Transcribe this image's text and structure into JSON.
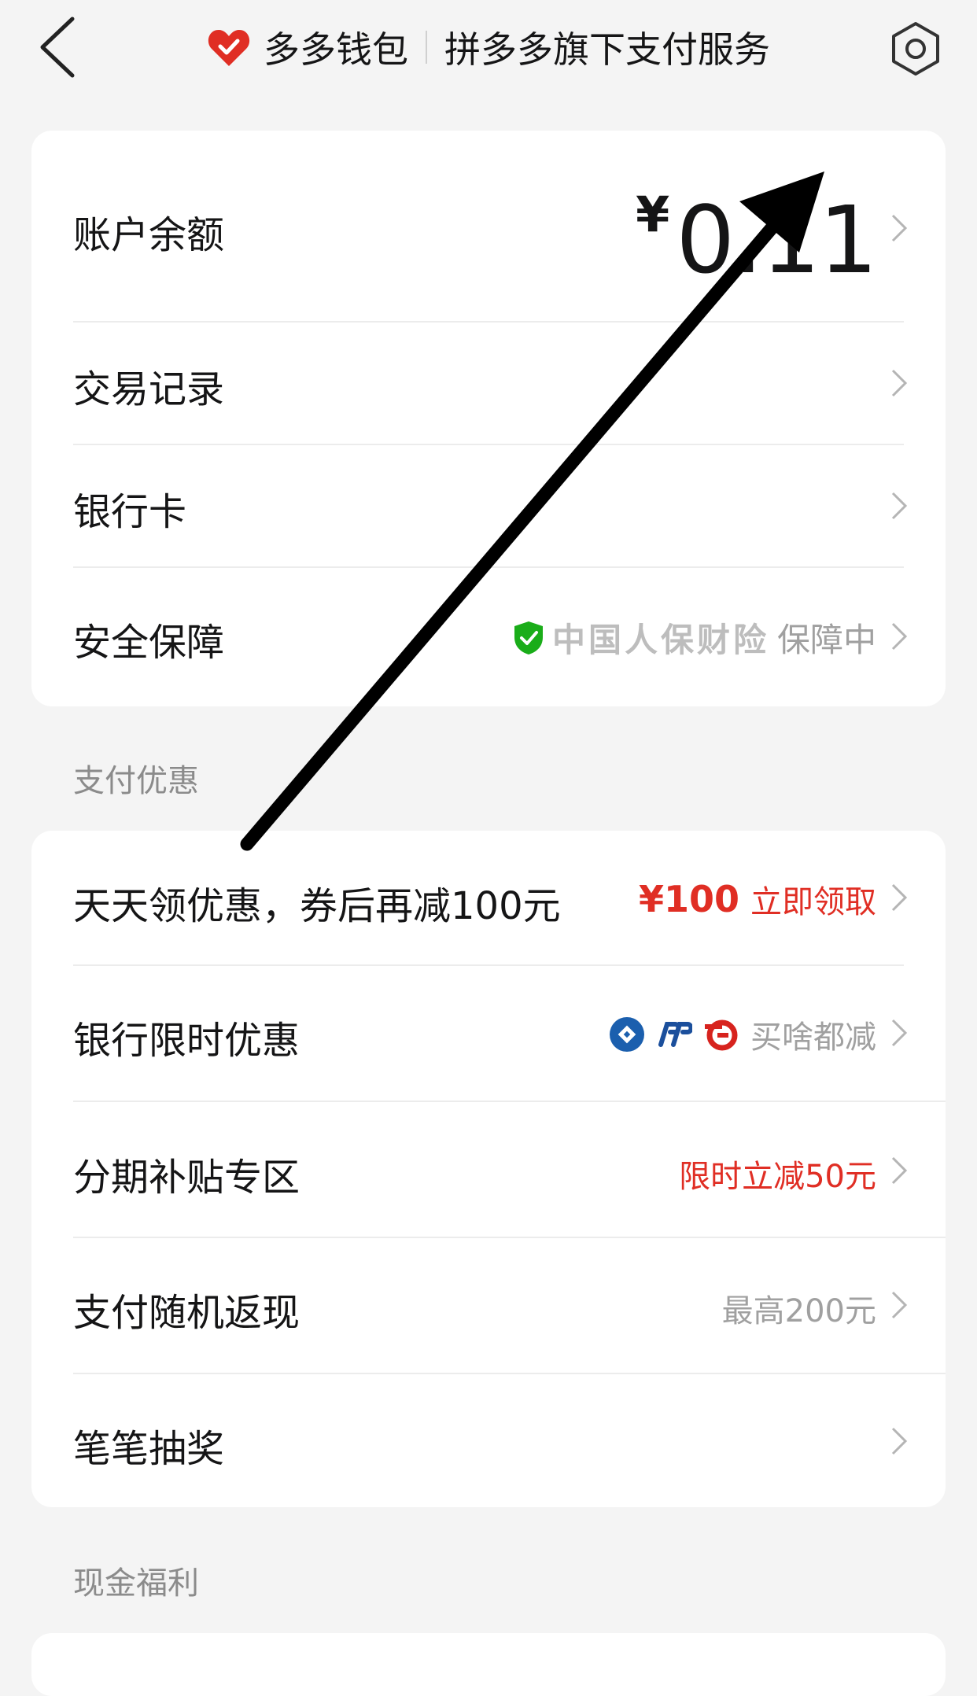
{
  "header": {
    "title": "多多钱包",
    "subtitle": "拼多多旗下支付服务"
  },
  "account": {
    "balance_label": "账户余额",
    "currency": "¥",
    "balance": "0.11",
    "records_label": "交易记录",
    "bank_card_label": "银行卡",
    "security_label": "安全保障",
    "insurer": "中国人保财险",
    "security_status": "保障中"
  },
  "promotions": {
    "section_title": "支付优惠",
    "items": [
      {
        "label": "天天领优惠，券后再减100元",
        "price": "¥100",
        "action": "立即领取"
      },
      {
        "label": "银行限时优惠",
        "note": "买啥都减"
      },
      {
        "label": "分期补贴专区",
        "note": "限时立减50元"
      },
      {
        "label": "支付随机返现",
        "note": "最高200元"
      },
      {
        "label": "笔笔抽奖"
      }
    ]
  },
  "cash_benefits": {
    "section_title": "现金福利"
  },
  "colors": {
    "accent_red": "#e02e24",
    "shield_green": "#1aad19",
    "background": "#f4f4f4"
  }
}
